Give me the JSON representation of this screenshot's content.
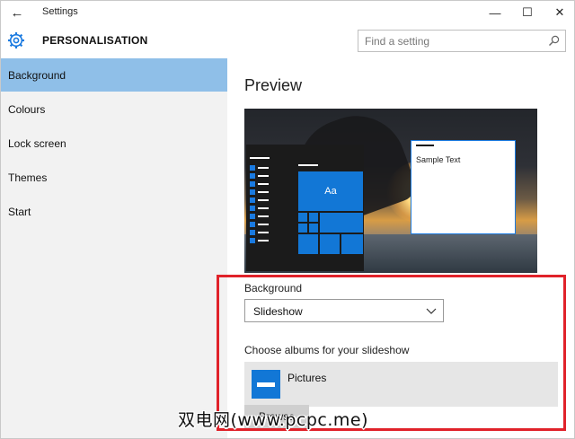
{
  "window": {
    "title": "Settings",
    "back_glyph": "←",
    "minimize_glyph": "—",
    "maximize_glyph": "☐",
    "close_glyph": "✕"
  },
  "header": {
    "app_title": "PERSONALISATION",
    "icon": "gear-icon",
    "search": {
      "placeholder": "Find a setting",
      "value": "",
      "icon": "search-icon"
    }
  },
  "sidebar": {
    "items": [
      {
        "label": "Background",
        "active": true
      },
      {
        "label": "Colours",
        "active": false
      },
      {
        "label": "Lock screen",
        "active": false
      },
      {
        "label": "Themes",
        "active": false
      },
      {
        "label": "Start",
        "active": false
      }
    ]
  },
  "main": {
    "preview_title": "Preview",
    "preview": {
      "tile_label": "Aa",
      "sample_text": "Sample Text"
    },
    "background_label": "Background",
    "background_value": "Slideshow",
    "albums_label": "Choose albums for your slideshow",
    "albums": [
      {
        "name": "Pictures",
        "icon": "folder-icon"
      }
    ],
    "browse_label": "Browse"
  },
  "colors": {
    "accent": "#1277d6",
    "sidebar_active": "#8fbfe8",
    "highlight_border": "#e0222a"
  },
  "watermark": "双电网(www.pcpc.me)"
}
